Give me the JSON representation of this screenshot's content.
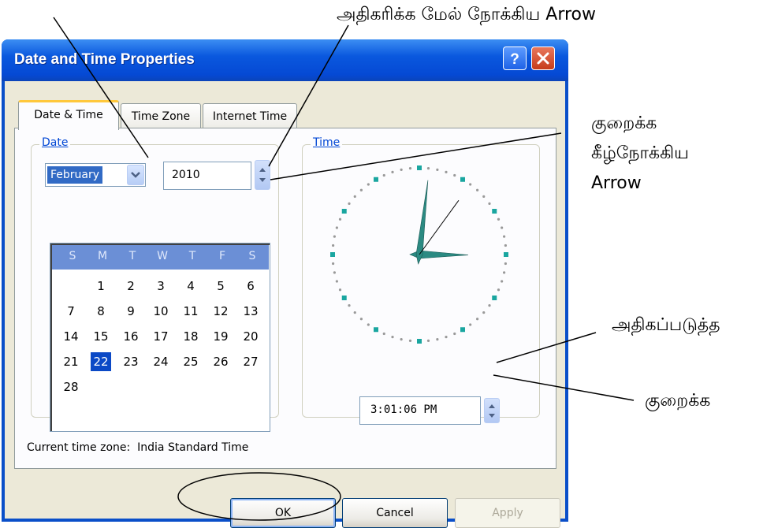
{
  "annotations": {
    "increase_arrow_top": "அதிகரிக்க மேல் நோக்கிய Arrow",
    "decrease_arrow_line1": "குறைக்க",
    "decrease_arrow_line2": "கீழ்நோக்கிய",
    "decrease_arrow_line3": "Arrow",
    "time_increase": "அதிகப்படுத்த",
    "time_decrease": "குறைக்க"
  },
  "window": {
    "title": "Date and Time Properties",
    "help_label": "?",
    "close_label": "✕"
  },
  "tabs": [
    {
      "label": "Date & Time",
      "active": true
    },
    {
      "label": "Time Zone",
      "active": false
    },
    {
      "label": "Internet Time",
      "active": false
    }
  ],
  "date_group": {
    "label": "Date",
    "month": "February",
    "year": "2010"
  },
  "calendar": {
    "weekdays": [
      "S",
      "M",
      "T",
      "W",
      "T",
      "F",
      "S"
    ],
    "selected_day": 22,
    "weeks": [
      [
        "",
        "1",
        "2",
        "3",
        "4",
        "5",
        "6"
      ],
      [
        "7",
        "8",
        "9",
        "10",
        "11",
        "12",
        "13"
      ],
      [
        "14",
        "15",
        "16",
        "17",
        "18",
        "19",
        "20"
      ],
      [
        "21",
        "22",
        "23",
        "24",
        "25",
        "26",
        "27"
      ],
      [
        "28",
        "",
        "",
        "",
        "",
        "",
        ""
      ]
    ]
  },
  "time_group": {
    "label": "Time",
    "time_value": "3:01:06 PM"
  },
  "clock": {
    "hour": 3,
    "minute": 1,
    "second": 6,
    "hand_color": "#2b8a82",
    "marker_color": "#1aa6a0"
  },
  "status": {
    "timezone_text": "Current time zone:  India Standard Time"
  },
  "buttons": {
    "ok": "OK",
    "cancel": "Cancel",
    "apply": "Apply"
  },
  "colors": {
    "titlebar": "#0a58de",
    "dialog_bg": "#ece9d8",
    "selection": "#316ac5",
    "calendar_header": "#6b8fd6",
    "group_label": "#0046d5"
  }
}
